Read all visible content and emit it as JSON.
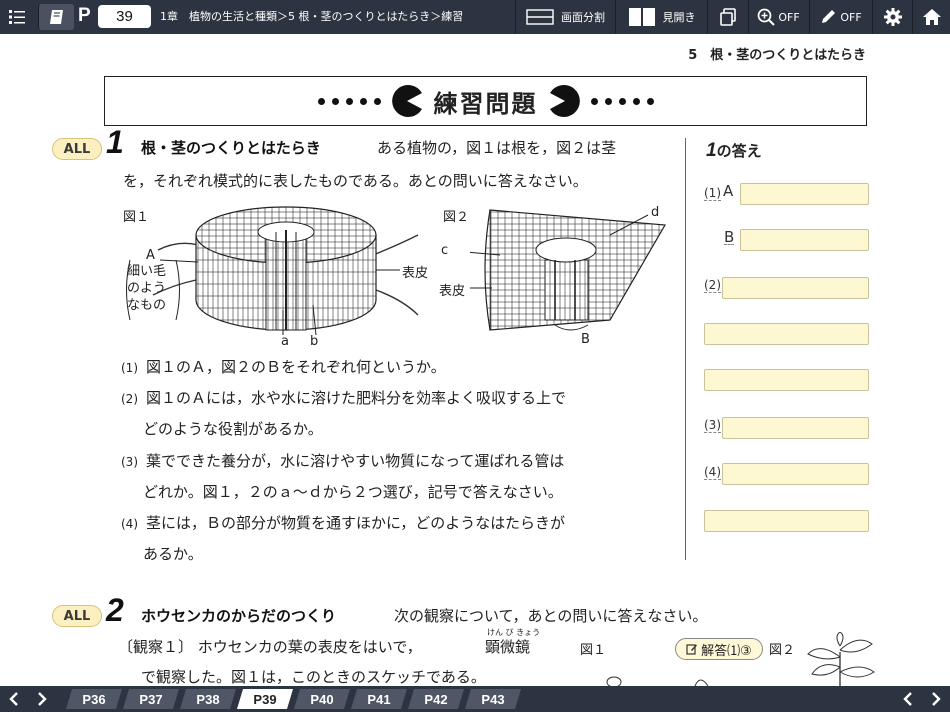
{
  "toolbar": {
    "page_label": "P",
    "page_number": "39",
    "breadcrumb": "1章　植物の生活と種類＞5 根・茎のつくりとはたらき＞練習",
    "split_label": "画面分割",
    "spread_label": "見開き",
    "zoom_label": "OFF",
    "pen_label": "OFF"
  },
  "page": {
    "header": "5　根・茎のつくりとはたらき",
    "title": "練習問題"
  },
  "q1": {
    "all_label": "ALL",
    "number": "1",
    "title": "根・茎のつくりとはたらき",
    "text_1": "ある植物の，図１は根を，図２は茎",
    "text_2": "を，それぞれ模式的に表したものである。あとの問いに答えなさい。",
    "fig1_label": "図１",
    "fig2_label": "図２",
    "fig1_A": "A",
    "fig1_hair_1": "細い毛",
    "fig1_hair_2": "のよう",
    "fig1_hair_3": "なもの",
    "fig1_a": "a",
    "fig1_b": "b",
    "fig1_epidermis": "表皮",
    "fig2_c": "c",
    "fig2_d": "d",
    "fig2_epidermis": "表皮",
    "fig2_B": "B",
    "sub": [
      {
        "num": "(1)",
        "line1": "図１のＡ，図２のＢをそれぞれ何というか。",
        "line2": ""
      },
      {
        "num": "(2)",
        "line1": "図１のＡには，水や水に溶けた肥料分を効率よく吸収する上で",
        "line2": "どのような役割があるか。"
      },
      {
        "num": "(3)",
        "line1": "葉でできた養分が，水に溶けやすい物質になって運ばれる管は",
        "line2": "どれか。図１，２のａ～ｄから２つ選び，記号で答えなさい。"
      },
      {
        "num": "(4)",
        "line1": "茎には，Ｂの部分が物質を通すほかに，どのようなはたらきが",
        "line2": "あるか。"
      }
    ]
  },
  "answers": {
    "title_num": "1",
    "title_text": "の答え",
    "label_1": "(1)",
    "label_1A": "A",
    "label_1B": "B",
    "label_2": "(2)",
    "label_3": "(3)",
    "label_4": "(4)"
  },
  "q2": {
    "all_label": "ALL",
    "number": "2",
    "title": "ホウセンカのからだのつくり",
    "text": "次の観察について，あとの問いに答えなさい。",
    "obs_1": "〔観察１〕 ホウセンカの葉の表皮をはいで，",
    "ruby": "けん び きょう",
    "kanji": "顕微鏡",
    "obs_2": "で観察した。図１は，このときのスケッチである。",
    "fig1_label": "図１",
    "fig2_label": "図２",
    "answer_button": "解答⑴③"
  },
  "bottom_nav": {
    "tabs": [
      "P36",
      "P37",
      "P38",
      "P39",
      "P40",
      "P41",
      "P42",
      "P43"
    ],
    "active_tab": "P39"
  }
}
